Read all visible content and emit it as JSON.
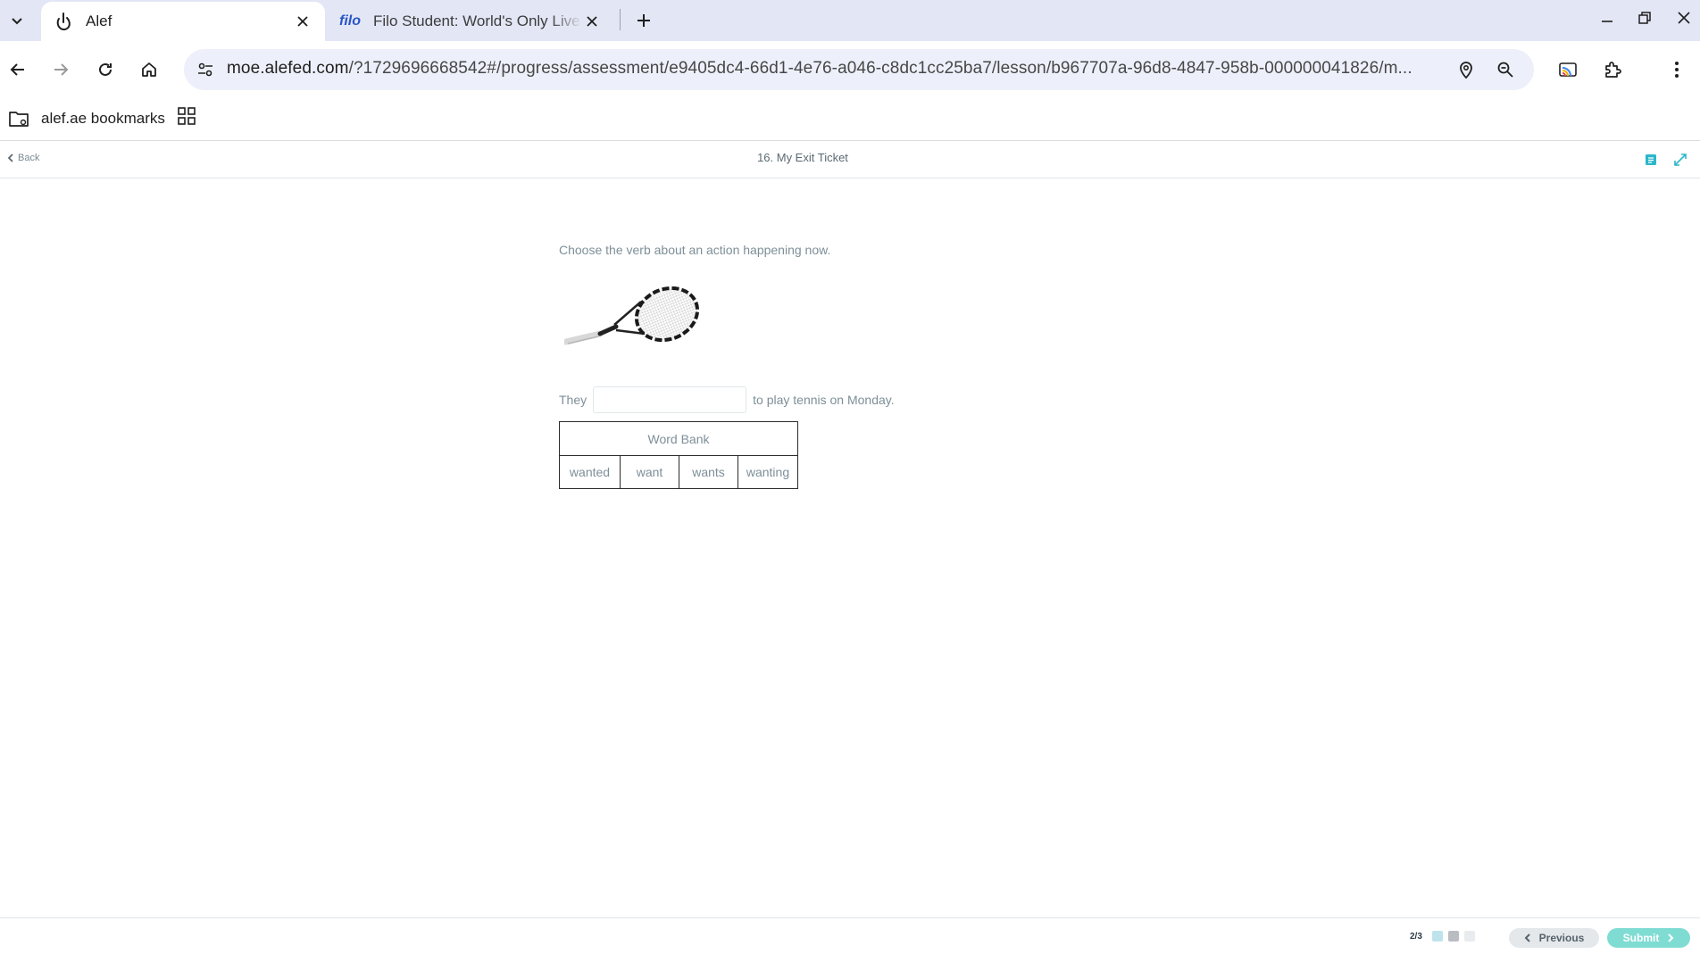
{
  "browser": {
    "tabs": [
      {
        "title": "Alef",
        "favicon": "alef-icon",
        "active": true
      },
      {
        "title": "Filo Student: World's Only Live I",
        "favicon_text": "filo",
        "active": false
      }
    ],
    "url_host": "moe.alefed.com",
    "url_rest": "/?1729696668542#/progress/assessment/e9405dc4-66d1-4e76-a046-c8dc1cc25ba7/lesson/b967707a-96d8-4847-958b-000000041826/m...",
    "bookmarks": [
      {
        "label": "alef.ae bookmarks"
      }
    ]
  },
  "page": {
    "back_label": "Back",
    "title": "16. My Exit Ticket"
  },
  "question": {
    "prompt": "Choose the verb about an action happening now.",
    "image": "tennis-racket",
    "sentence_before": "They",
    "sentence_after": "to play tennis on Monday.",
    "blank_value": ""
  },
  "word_bank": {
    "header": "Word Bank",
    "words": [
      "wanted",
      "want",
      "wants",
      "wanting"
    ]
  },
  "footer": {
    "pager": "2/3",
    "previous_label": "Previous",
    "submit_label": "Submit"
  },
  "colors": {
    "accent": "#2bb7c9",
    "submit_bg": "#7fdcd3",
    "text_muted": "#7e8f98"
  }
}
